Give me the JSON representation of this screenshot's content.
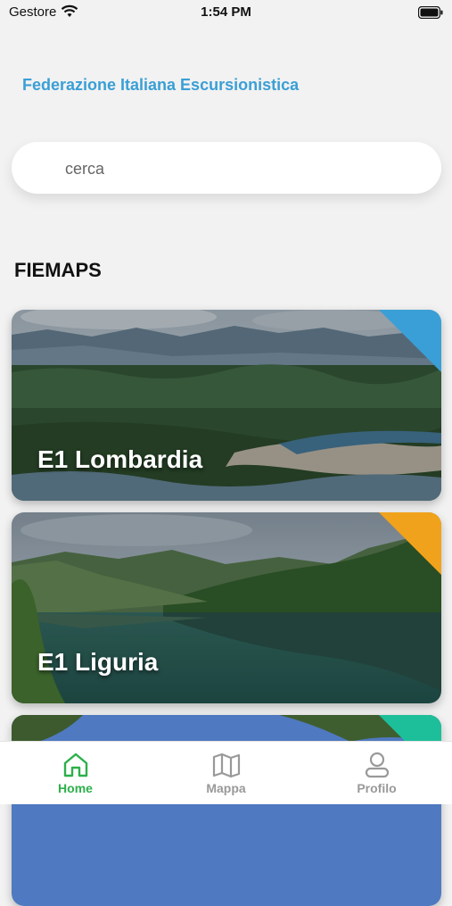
{
  "status_bar": {
    "carrier": "Gestore",
    "time": "1:54 PM",
    "wifi_icon": "wifi-icon",
    "battery_icon": "battery-icon"
  },
  "header": {
    "title": "Federazione Italiana Escursionistica"
  },
  "search": {
    "placeholder": "cerca"
  },
  "section": {
    "title": "FIEMAPS"
  },
  "cards": [
    {
      "label": "E1 Lombardia",
      "accent": "#3a9fd6"
    },
    {
      "label": "E1 Liguria",
      "accent": "#f0a21c"
    },
    {
      "label": "",
      "accent": "#1dbf9a"
    }
  ],
  "tab_bar": {
    "tabs": [
      {
        "label": "Home",
        "icon": "home-icon",
        "active": true
      },
      {
        "label": "Mappa",
        "icon": "map-icon",
        "active": false
      },
      {
        "label": "Profilo",
        "icon": "profile-icon",
        "active": false
      }
    ],
    "active_color": "#2db04b",
    "inactive_color": "#999999"
  }
}
